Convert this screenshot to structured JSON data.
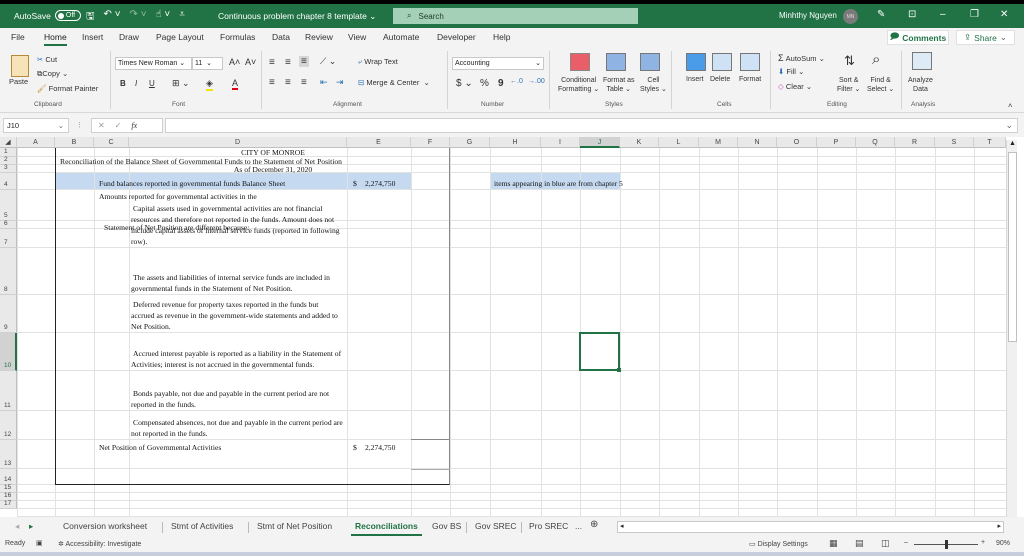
{
  "titlebar": {
    "autosave_label": "AutoSave",
    "autosave_state": "Off",
    "doc_title": "Continuous problem chapter 8 template",
    "search_placeholder": "Search",
    "user_name": "Minhthy Nguyen",
    "user_initials": "MN"
  },
  "menu": {
    "tabs": [
      "File",
      "Home",
      "Insert",
      "Draw",
      "Page Layout",
      "Formulas",
      "Data",
      "Review",
      "View",
      "Automate",
      "Developer",
      "Help"
    ],
    "active": "Home",
    "comments_label": "Comments",
    "share_label": "Share"
  },
  "ribbon": {
    "clipboard": {
      "paste": "Paste",
      "cut": "Cut",
      "copy": "Copy",
      "format_painter": "Format Painter",
      "group": "Clipboard"
    },
    "font": {
      "family": "Times New Roman",
      "size": "11",
      "bold": "B",
      "italic": "I",
      "underline": "U",
      "group": "Font"
    },
    "alignment": {
      "wrap_text": "Wrap Text",
      "merge_center": "Merge & Center",
      "group": "Alignment"
    },
    "number": {
      "format": "Accounting",
      "currency": "$",
      "percent": "%",
      "comma": "9",
      "group": "Number"
    },
    "styles": {
      "conditional": "Conditional",
      "conditional2": "Formatting",
      "format_as": "Format as",
      "format_as2": "Table",
      "cell": "Cell",
      "cell2": "Styles",
      "group": "Styles"
    },
    "cells": {
      "insert": "Insert",
      "delete": "Delete",
      "format": "Format",
      "group": "Cells"
    },
    "editing": {
      "autosum": "AutoSum",
      "fill": "Fill",
      "clear": "Clear",
      "sort": "Sort &",
      "sort2": "Filter",
      "find": "Find &",
      "find2": "Select",
      "group": "Editing"
    },
    "analysis": {
      "analyze": "Analyze",
      "analyze2": "Data",
      "group": "Analysis"
    }
  },
  "formula_bar": {
    "name_box": "J10",
    "fx": "fx",
    "formula": ""
  },
  "grid": {
    "columns": [
      "A",
      "B",
      "C",
      "D",
      "E",
      "F",
      "G",
      "H",
      "I",
      "J",
      "K",
      "L",
      "M",
      "N",
      "O",
      "P",
      "Q",
      "R",
      "S",
      "T"
    ],
    "rows": [
      "1",
      "2",
      "3",
      "4",
      "5",
      "6",
      "7",
      "8",
      "9",
      "10",
      "11",
      "12",
      "13",
      "14",
      "15",
      "16",
      "17"
    ],
    "selected_column": "J",
    "selected_row": "10",
    "cells": {
      "title": "CITY OF MONROE",
      "subtitle": "Reconciliation of the Balance Sheet of Governmental Funds to the Statement of Net Position",
      "date": "As of December 31, 2020",
      "fund_balances_label": "Fund balances reported in governmental funds Balance Sheet",
      "fund_balances_currency": "$",
      "fund_balances_value": "2,274,750",
      "note": "items appearing in blue are from chapter 5",
      "amounts_line1": "Amounts reported for governmental activities in the",
      "amounts_line2": "Statement of Net Position are different because:",
      "item_capital": "Capital assets used in governmental activities are not financial resources and therefore not reported in the funds. Amount does not include capital assets of internal service funds (reported in following row).",
      "item_internal": "The assets and liabilities of internal service funds are included in governmental funds in the Statement of Net Position.",
      "item_deferred": "Deferred revenue for property taxes reported in the funds but accrued as revenue in the government-wide statements and added to Net Position.",
      "item_interest": "Accrued interest payable is reported as a liability in the Statement of Activities; interest is not accrued in the governmental funds.",
      "item_bonds": "Bonds payable, not due and payable in the current period are not reported in the funds.",
      "item_compensated": "Compensated absences, not due and payable in the current period are not reported in the funds.",
      "net_position_label": "Net Position of Governmental Activities",
      "net_position_currency": "$",
      "net_position_value": "2,274,750"
    }
  },
  "sheets": {
    "tabs": [
      "Conversion worksheet",
      "Stmt of Activities",
      "Stmt of Net Position",
      "Reconciliations",
      "Gov BS",
      "Gov SREC",
      "Pro SREC"
    ],
    "active": "Reconciliations",
    "more": "..."
  },
  "status": {
    "ready": "Ready",
    "accessibility": "Accessibility: Investigate",
    "display_settings": "Display Settings",
    "zoom": "90%",
    "zoom_fraction": 0.5
  },
  "colors": {
    "accent": "#217346",
    "highlight_blue": "#c5d9f1"
  }
}
